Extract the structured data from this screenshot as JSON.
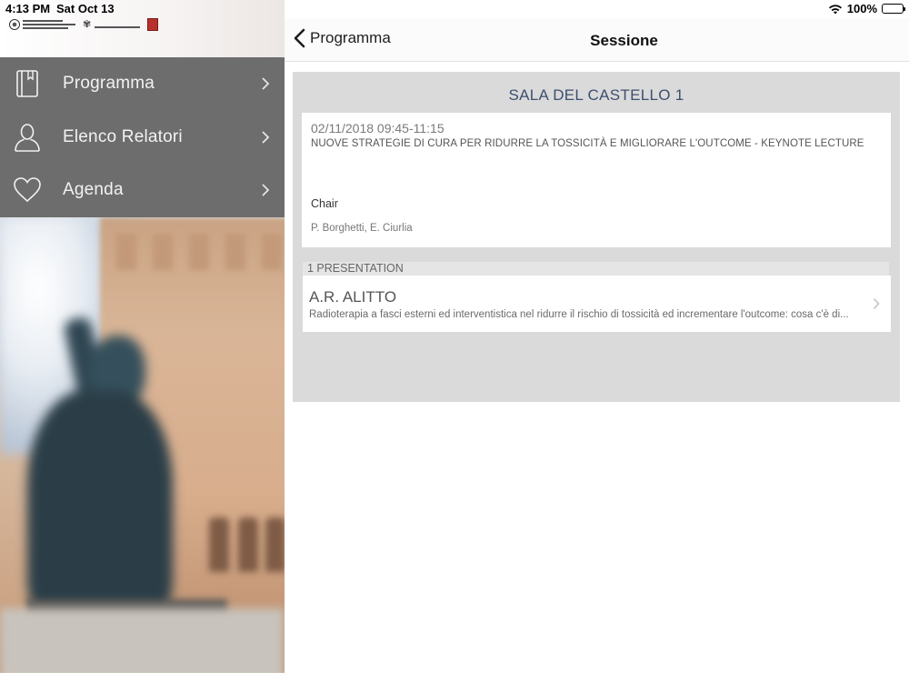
{
  "status_bar": {
    "time": "4:13 PM",
    "date": "Sat Oct 13",
    "battery_label": "100%",
    "battery_level": 1.0
  },
  "sidebar": {
    "logos": [
      "association-logo",
      "society-logo",
      "city-crest-logo"
    ],
    "items": [
      {
        "label": "Programma",
        "icon": "book-icon"
      },
      {
        "label": "Elenco Relatori",
        "icon": "person-icon"
      },
      {
        "label": "Agenda",
        "icon": "heart-icon"
      }
    ],
    "colors": {
      "menu_background": "#6d6d6d",
      "menu_text": "#f2f2f2"
    }
  },
  "navbar": {
    "back_label": "Programma",
    "title": "Sessione"
  },
  "session": {
    "room": "SALA DEL CASTELLO 1",
    "datetime": "02/11/2018 09:45-11:15",
    "title": "NUOVE STRATEGIE DI CURA PER RIDURRE LA TOSSICITÀ E MIGLIORARE L'OUTCOME - KEYNOTE LECTURE",
    "chair_label": "Chair",
    "chairs": "P. Borghetti, E. Ciurlia"
  },
  "presentations": {
    "header": "1 PRESENTATION",
    "items": [
      {
        "speaker": "A.R. ALITTO",
        "description": "Radioterapia a fasci esterni ed interventistica nel ridurre il rischio di tossicità ed incrementare l'outcome: cosa c'è di..."
      }
    ]
  },
  "colors": {
    "room_title": "#3d4f6e",
    "panel_background": "#dadada"
  }
}
